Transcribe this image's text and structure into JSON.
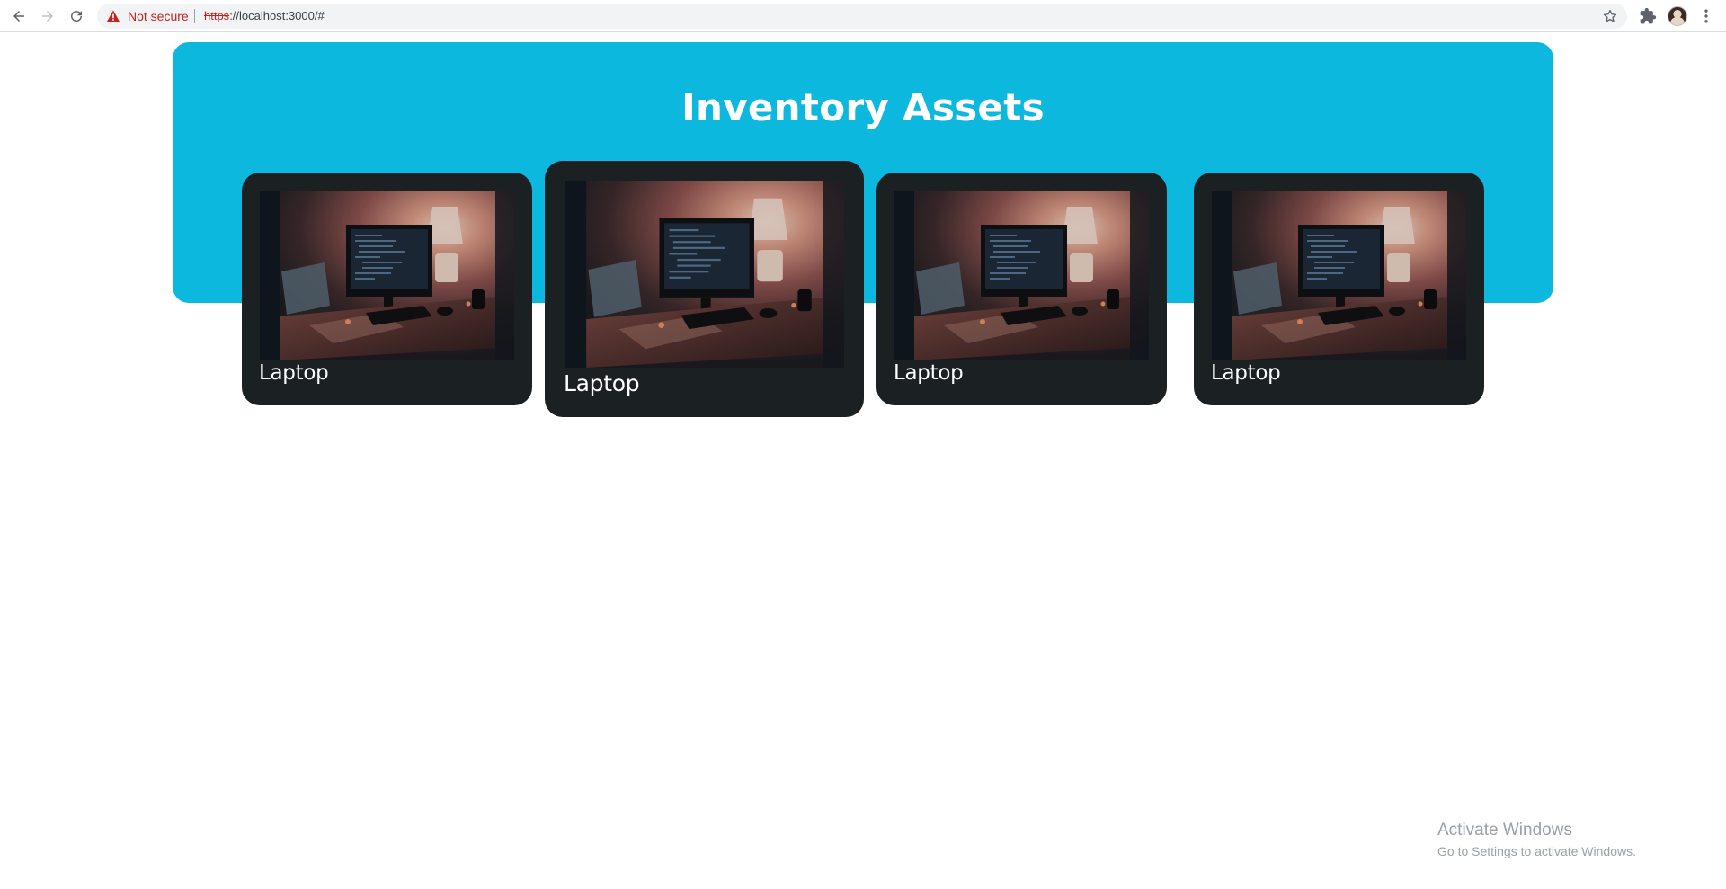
{
  "browser": {
    "security_label": "Not secure",
    "url_scheme": "https",
    "url_rest": "://localhost:3000/#"
  },
  "page": {
    "title": "Inventory Assets",
    "cards": [
      {
        "label": "Laptop",
        "icon": "desk-computer-photo"
      },
      {
        "label": "Laptop",
        "icon": "desk-computer-photo"
      },
      {
        "label": "Laptop",
        "icon": "desk-computer-photo"
      },
      {
        "label": "Laptop",
        "icon": "desk-computer-photo"
      }
    ]
  },
  "watermark": {
    "line1": "Activate Windows",
    "line2": "Go to Settings to activate Windows."
  },
  "colors": {
    "hero": "#0db8df",
    "card": "#1b2023",
    "not_secure": "#c5221f"
  }
}
